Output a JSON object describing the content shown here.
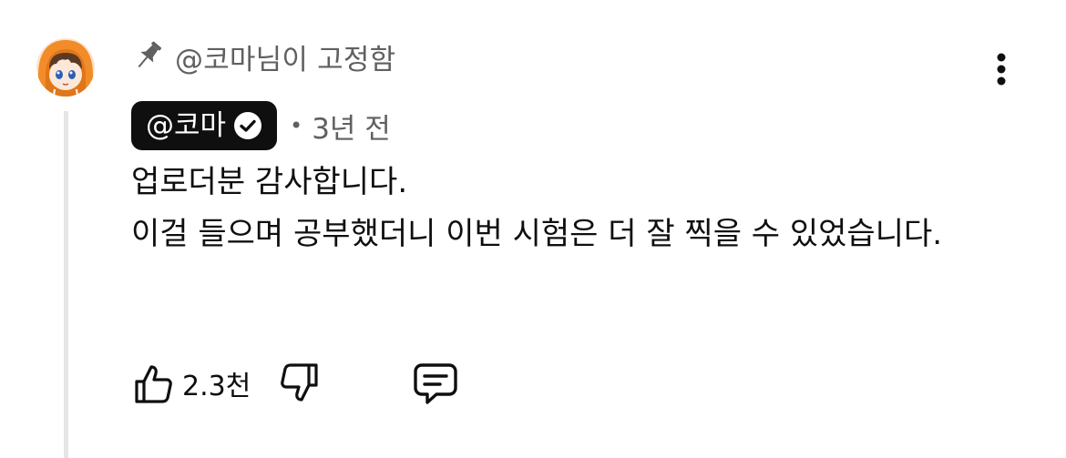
{
  "pinned": {
    "text": "@코마님이 고정함",
    "icon": "pin-icon"
  },
  "author": {
    "name": "@코마",
    "verified_icon": "verified-check-icon",
    "separator": "•",
    "time_ago": "3년 전"
  },
  "comment": {
    "line1": "업로더분 감사합니다.",
    "line2": "이걸 들으며 공부했더니 이번 시험은 더 잘 찍을 수 있었습니다."
  },
  "actions": {
    "like_icon": "thumbs-up-icon",
    "like_count": "2.3천",
    "dislike_icon": "thumbs-down-icon",
    "reply_icon": "reply-comment-icon"
  },
  "menu": {
    "icon": "more-vertical-icon"
  },
  "colors": {
    "text": "#0f0f0f",
    "secondary": "#606060",
    "badge_bg": "#0f0f0f",
    "thread_line": "#e5e5e5",
    "avatar_orange": "#f28c28"
  }
}
